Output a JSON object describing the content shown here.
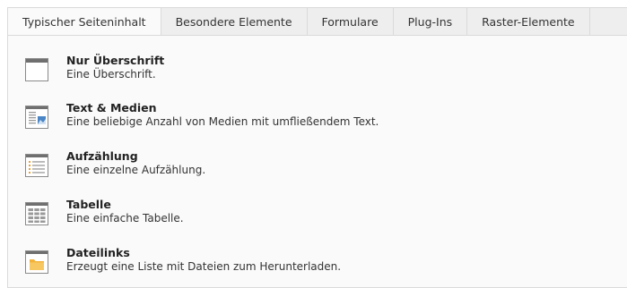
{
  "tabs": [
    {
      "label": "Typischer Seiteninhalt",
      "active": true
    },
    {
      "label": "Besondere Elemente",
      "active": false
    },
    {
      "label": "Formulare",
      "active": false
    },
    {
      "label": "Plug-Ins",
      "active": false
    },
    {
      "label": "Raster-Elemente",
      "active": false
    }
  ],
  "items": [
    {
      "title": "Nur Überschrift",
      "description": "Eine Überschrift.",
      "icon": "header-icon"
    },
    {
      "title": "Text & Medien",
      "description": "Eine beliebige Anzahl von Medien mit umfließendem Text.",
      "icon": "text-media-icon"
    },
    {
      "title": "Aufzählung",
      "description": "Eine einzelne Aufzählung.",
      "icon": "bullet-list-icon"
    },
    {
      "title": "Tabelle",
      "description": "Eine einfache Tabelle.",
      "icon": "table-icon"
    },
    {
      "title": "Dateilinks",
      "description": "Erzeugt eine Liste mit Dateien zum Herunterladen.",
      "icon": "file-links-icon"
    }
  ],
  "colors": {
    "accent_blue": "#4a86c5",
    "folder_orange": "#f3b33a",
    "icon_gray": "#7a7a7a"
  }
}
